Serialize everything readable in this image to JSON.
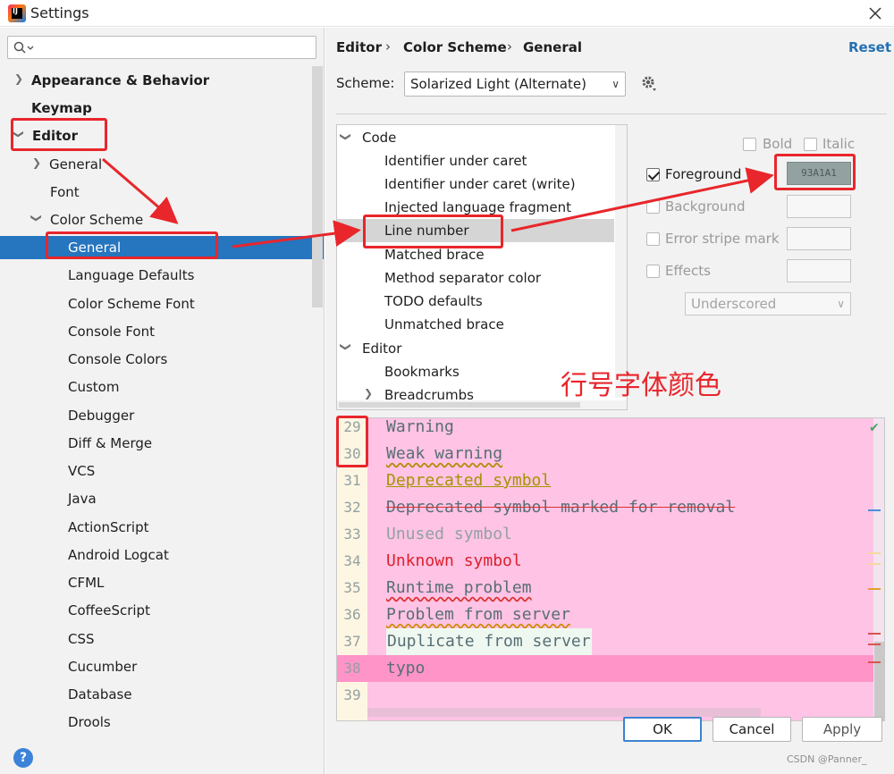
{
  "window": {
    "title": "Settings"
  },
  "search": {
    "placeholder": ""
  },
  "sidebar": {
    "items": [
      {
        "label": "Appearance & Behavior"
      },
      {
        "label": "Keymap"
      },
      {
        "label": "Editor"
      },
      {
        "label": "General"
      },
      {
        "label": "Font"
      },
      {
        "label": "Color Scheme"
      },
      {
        "label": "General"
      },
      {
        "label": "Language Defaults"
      },
      {
        "label": "Color Scheme Font"
      },
      {
        "label": "Console Font"
      },
      {
        "label": "Console Colors"
      },
      {
        "label": "Custom"
      },
      {
        "label": "Debugger"
      },
      {
        "label": "Diff & Merge"
      },
      {
        "label": "VCS"
      },
      {
        "label": "Java"
      },
      {
        "label": "ActionScript"
      },
      {
        "label": "Android Logcat"
      },
      {
        "label": "CFML"
      },
      {
        "label": "CoffeeScript"
      },
      {
        "label": "CSS"
      },
      {
        "label": "Cucumber"
      },
      {
        "label": "Database"
      },
      {
        "label": "Drools"
      }
    ]
  },
  "breadcrumb": {
    "part1": "Editor",
    "part2": "Color Scheme",
    "part3": "General",
    "separator": "›"
  },
  "reset_label": "Reset",
  "scheme": {
    "label": "Scheme:",
    "value": "Solarized Light (Alternate)"
  },
  "attributes": {
    "items": [
      {
        "label": "Code"
      },
      {
        "label": "Identifier under caret"
      },
      {
        "label": "Identifier under caret (write)"
      },
      {
        "label": "Injected language fragment"
      },
      {
        "label": "Line number"
      },
      {
        "label": "Matched brace"
      },
      {
        "label": "Method separator color"
      },
      {
        "label": "TODO defaults"
      },
      {
        "label": "Unmatched brace"
      },
      {
        "label": "Editor"
      },
      {
        "label": "Bookmarks"
      },
      {
        "label": "Breadcrumbs"
      }
    ]
  },
  "options": {
    "bold": "Bold",
    "italic": "Italic",
    "foreground": "Foreground",
    "foreground_value": "93A1A1",
    "foreground_checked": true,
    "background": "Background",
    "error_stripe": "Error stripe mark",
    "effects": "Effects",
    "effect_type": "Underscored"
  },
  "annotation": "行号字体颜色",
  "preview": {
    "lines": [
      {
        "num": "29",
        "text": "Warning"
      },
      {
        "num": "30",
        "text": "Weak warning"
      },
      {
        "num": "31",
        "text": "Deprecated symbol"
      },
      {
        "num": "32",
        "text": "Deprecated symbol marked for removal"
      },
      {
        "num": "33",
        "text": "Unused symbol"
      },
      {
        "num": "34",
        "text": "Unknown symbol"
      },
      {
        "num": "35",
        "text": "Runtime problem"
      },
      {
        "num": "36",
        "text": "Problem from server"
      },
      {
        "num": "37",
        "text": "Duplicate from server"
      },
      {
        "num": "38",
        "text": "typo"
      },
      {
        "num": "39",
        "text": ""
      }
    ]
  },
  "buttons": {
    "ok": "OK",
    "cancel": "Cancel",
    "apply": "Apply"
  },
  "help": "?",
  "watermark": "CSDN @Panner_",
  "colors": {
    "selection": "#2675bf",
    "preview_bg": "#fec3e5",
    "line_number": "#93a1a1",
    "annotation": "#e9252c"
  }
}
